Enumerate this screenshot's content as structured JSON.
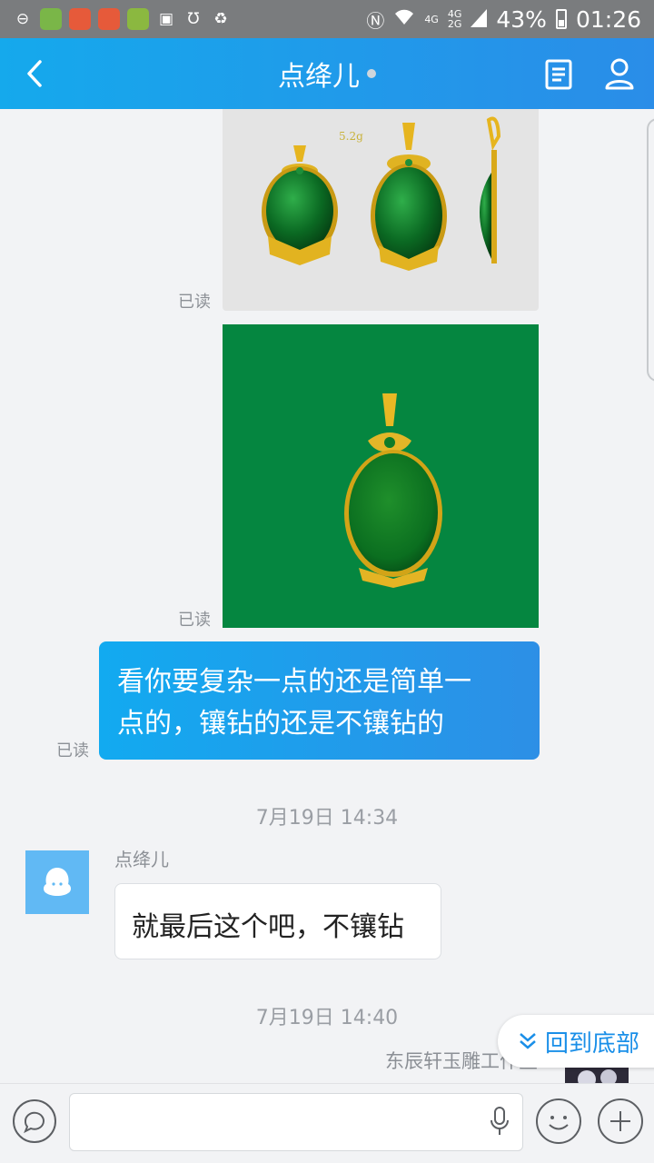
{
  "status_bar": {
    "battery": "43%",
    "time": "01:26",
    "net_top": "4G",
    "net_bottom": "2G",
    "net_primary": "4G"
  },
  "header": {
    "title": "点绛儿"
  },
  "messages": {
    "read_label": "已读",
    "image1_caption": "5.2g",
    "outgoing_text_line1": "看你要复杂一点的还是简单一",
    "outgoing_text_line2": "点的，镶钻的还是不镶钻的",
    "time1": "7月19日 14:34",
    "sender1": "点绛儿",
    "incoming_text": "就最后这个吧，不镶钻",
    "time2": "7月19日 14:40",
    "sender2": "东辰轩玉雕工作室"
  },
  "scroll_to_bottom": {
    "label": "回到底部"
  },
  "colors": {
    "accent": "#1a8fe8",
    "header_start": "#15a9ec",
    "header_end": "#2a8de8",
    "jade_bg": "#058640"
  }
}
